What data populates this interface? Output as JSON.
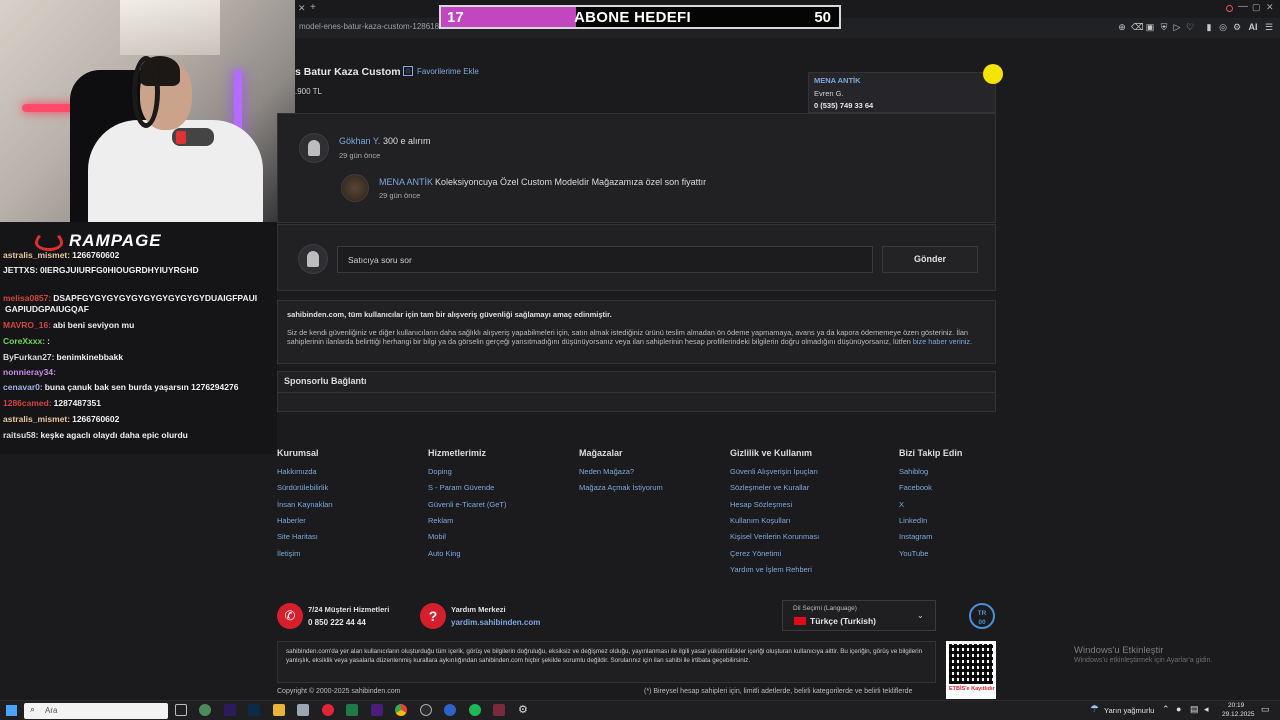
{
  "browser": {
    "url": "model-enes-batur-kaza-custom-1286186302/..."
  },
  "goal": {
    "current": "17",
    "title": "ABONE HEDEFI",
    "target": "50",
    "progress": 0.34,
    "bar_color": "#c246bf"
  },
  "overlay": {
    "logo": "RAMPAGE"
  },
  "chat": [
    {
      "user": "astralis_mismet:",
      "msg": "1266760602",
      "color": "#e8c6a0"
    },
    {
      "user": "JETTXS:",
      "msg": "0IERGJUIURFG0HIOUGRDHYIUYRGHD",
      "color": "#f1f1f1"
    },
    {
      "user": "melisa0857:",
      "msg": "DSAPFGYGYGYGYGYGYGYGYGYGYDUAIGFPAUI",
      "color": "#d24444"
    },
    {
      "user": "",
      "msg": "GAPIUDGPAIUGQAF",
      "color": "#f1f1f1"
    },
    {
      "user": "MAVRO_16:",
      "msg": "abi beni seviyon mu",
      "color": "#d24444"
    },
    {
      "user": "CoreXxxx:",
      "msg": ":",
      "color": "#6bd65b"
    },
    {
      "user": "ByFurkan27:",
      "msg": "benimkinebbakk",
      "color": "#dcdcdc"
    },
    {
      "user": "nonnieray34:",
      "msg": "",
      "color": "#c98be8"
    },
    {
      "user": "cenavar0:",
      "msg": "buna çanuk bak sen burda yaşarsın 1276294276",
      "color": "#9fb4e6"
    },
    {
      "user": "1286camed:",
      "msg": "1287487351",
      "color": "#d24444"
    },
    {
      "user": "astralis_mismet:",
      "msg": "1266760602",
      "color": "#e8c6a0"
    },
    {
      "user": "raitsu58:",
      "msg": "keşke agaclı olaydı daha epic olurdu",
      "color": "#dcdcdc"
    }
  ],
  "listing": {
    "title": "s Batur Kaza Custom",
    "favorite": "Favorilerime Ekle",
    "price": ".900 TL"
  },
  "seller_box": {
    "name": "MENA ANTİK",
    "contact": "Evren G.",
    "phone": "0 (535) 749 33 64"
  },
  "comments": [
    {
      "user": "Gökhan Y.",
      "text": "300 e alırım",
      "time": "29 gün önce"
    },
    {
      "user": "MENA ANTİK",
      "text": "Koleksiyoncuya Özel Custom Modeldir Mağazamıza özel son fiyattır",
      "time": "29 gün önce"
    }
  ],
  "question": {
    "placeholder": "Satıcıya soru sor",
    "button": "Gönder"
  },
  "safety": {
    "heading": "sahibinden.com, tüm kullanıcılar için tam bir alışveriş güvenliği sağlamayı amaç edinmiştir.",
    "body": "Siz de kendi güvenliğiniz ve diğer kullanıcıların daha sağlıklı alışveriş yapabilmeleri için, satın almak istediğiniz ürünü teslim almadan ön ödeme yapmamaya, avans ya da kapora ödememeye özen gösteriniz. İlan sahiplerinin ilanlarda belirttiği herhangi bir bilgi ya da görselin gerçeği yansıtmadığını düşünüyorsanız veya ilan sahiplerinin hesap profillerindeki bilgilerin doğru olmadığını düşünüyorsanız, lütfen",
    "link": "bize haber veriniz."
  },
  "sponsored": {
    "title": "Sponsorlu Bağlantı"
  },
  "footer": {
    "columns": [
      {
        "title": "Kurumsal",
        "links": [
          "Hakkımızda",
          "Sürdürülebilirlik",
          "İnsan Kaynakları",
          "Haberler",
          "Site Haritası",
          "İletişim"
        ]
      },
      {
        "title": "Hizmetlerimiz",
        "links": [
          "Doping",
          "S - Param Güvende",
          "Güvenli e-Ticaret (GeT)",
          "Reklam",
          "Mobil",
          "Auto King"
        ]
      },
      {
        "title": "Mağazalar",
        "links": [
          "Neden Mağaza?",
          "Mağaza Açmak İstiyorum"
        ]
      },
      {
        "title": "Gizlilik ve Kullanım",
        "links": [
          "Güvenli Alışverişin İpuçları",
          "Sözleşmeler ve Kurallar",
          "Hesap Sözleşmesi",
          "Kullanım Koşulları",
          "Kişisel Verilerin Korunması",
          "Çerez Yönetimi",
          "Yardım ve İşlem Rehberi"
        ]
      },
      {
        "title": "Bizi Takip Edin",
        "links": [
          "Sahiblog",
          "Facebook",
          "X",
          "LinkedIn",
          "Instagram",
          "YouTube"
        ]
      }
    ],
    "support": {
      "title": "7/24 Müşteri Hizmetleri",
      "phone": "0 850 222 44 44"
    },
    "help": {
      "title": "Yardım Merkezi",
      "link": "yardim.sahibinden.com"
    },
    "language": {
      "label": "Dil Seçimi (Language)",
      "value": "Türkçe (Turkish)"
    },
    "disclaimer": "sahibinden.com'da yer alan kullanıcıların oluşturduğu tüm içerik, görüş ve bilgilerin doğruluğu, eksiksiz ve değişmez olduğu, yayınlanması ile ilgili yasal yükümlülükler içeriği oluşturan kullanıcıya aittir. Bu içeriğin, görüş ve bilgilerin yanlışlık, eksiklik veya yasalarla düzenlenmiş kurallara aykırılığından sahibinden.com hiçbir şekilde sorumlu değildir. Sorularınız için ilan sahibi ile irtibata geçebilirsiniz.",
    "copyright": "Copyright © 2000-2025 sahibinden.com",
    "note": "(*) Bireysel hesap sahipleri için, limitli adetlerde, belirli kategorilerde ve belirli tekliflerde",
    "etbis": "ETBİS'e Kayıtlıdır"
  },
  "activation": {
    "title": "Windows'u Etkinleştir",
    "text": "Windows'u etkinleştirmek için Ayarlar'a gidin."
  },
  "taskbar": {
    "search": "Ara",
    "weather": "Yarın yağmurlu",
    "time": "20:19",
    "date": "29.12.2025"
  }
}
